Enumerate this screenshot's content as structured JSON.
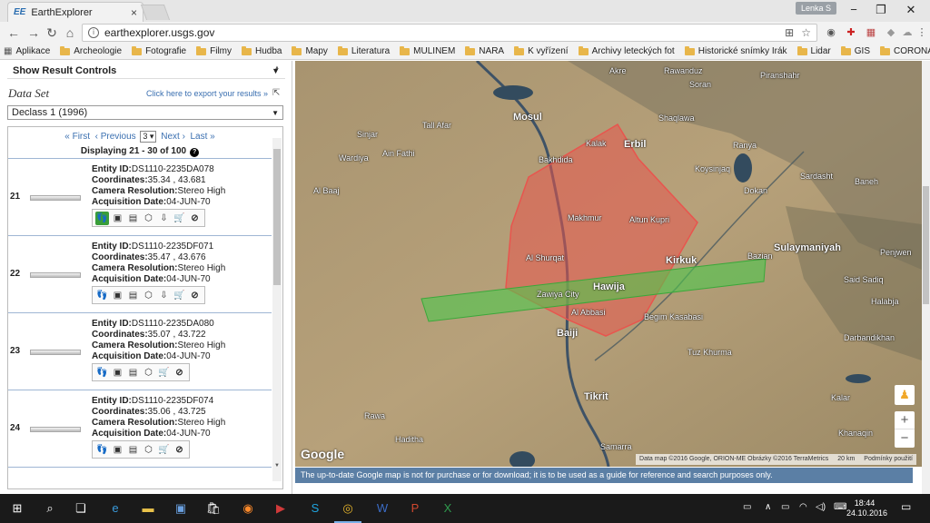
{
  "browser": {
    "tab_title": "EarthExplorer",
    "tab_icon": "EE",
    "user": "Lenka S",
    "url": "earthexplorer.usgs.gov",
    "bookmarks": [
      {
        "label": "Aplikace",
        "type": "apps"
      },
      {
        "label": "Archeologie",
        "type": "folder"
      },
      {
        "label": "Fotografie",
        "type": "folder"
      },
      {
        "label": "Filmy",
        "type": "folder"
      },
      {
        "label": "Hudba",
        "type": "folder"
      },
      {
        "label": "Mapy",
        "type": "folder"
      },
      {
        "label": "Literatura",
        "type": "folder"
      },
      {
        "label": "MULINEM",
        "type": "folder"
      },
      {
        "label": "NARA",
        "type": "folder"
      },
      {
        "label": "K vyřízení",
        "type": "folder"
      },
      {
        "label": "Archivy leteckých fot",
        "type": "folder"
      },
      {
        "label": "Historické snímky Irák",
        "type": "folder"
      },
      {
        "label": "Lidar",
        "type": "folder"
      },
      {
        "label": "GIS",
        "type": "folder"
      },
      {
        "label": "CORONA",
        "type": "folder"
      }
    ]
  },
  "panel": {
    "result_controls": "Show Result Controls",
    "dataset_title": "Data Set",
    "export_link": "Click here to export your results »",
    "dataset_value": "Declass 1 (1996)",
    "pager": {
      "first": "« First",
      "previous": "‹ Previous",
      "page": "3",
      "next": "Next ›",
      "last": "Last »"
    },
    "displaying": "Displaying 21 - 30 of 100",
    "results": [
      {
        "num": "21",
        "entity_label": "Entity ID:",
        "entity": "DS1110-2235DA078",
        "coord_label": "Coordinates:",
        "coords": "35.34 , 43.681",
        "res_label": "Camera Resolution:",
        "res": "Stereo High",
        "date_label": "Acquisition Date:",
        "date": "04-JUN-70"
      },
      {
        "num": "22",
        "entity_label": "Entity ID:",
        "entity": "DS1110-2235DF071",
        "coord_label": "Coordinates:",
        "coords": "35.47 , 43.676",
        "res_label": "Camera Resolution:",
        "res": "Stereo High",
        "date_label": "Acquisition Date:",
        "date": "04-JUN-70"
      },
      {
        "num": "23",
        "entity_label": "Entity ID:",
        "entity": "DS1110-2235DA080",
        "coord_label": "Coordinates:",
        "coords": "35.07 , 43.722",
        "res_label": "Camera Resolution:",
        "res": "Stereo High",
        "date_label": "Acquisition Date:",
        "date": "04-JUN-70"
      },
      {
        "num": "24",
        "entity_label": "Entity ID:",
        "entity": "DS1110-2235DF074",
        "coord_label": "Coordinates:",
        "coords": "35.06 , 43.725",
        "res_label": "Camera Resolution:",
        "res": "Stereo High",
        "date_label": "Acquisition Date:",
        "date": "04-JUN-70"
      }
    ]
  },
  "map": {
    "places": {
      "mosul": "Mosul",
      "erbil": "Erbil",
      "kirkuk": "Kirkuk",
      "sulaymaniyah": "Sulaymaniyah",
      "tal_afar": "Tall Afar",
      "sinjar": "Sinjar",
      "makhmur": "Makhmur",
      "altun_kupri": "Altun Kupri",
      "hawija": "Hawija",
      "baiji": "Baiji",
      "tikrit": "Tikrit",
      "tuz_khurma": "Tuz Khurma",
      "soran": "Soran",
      "rawanduz": "Rawanduz",
      "shaqlawa": "Shaqlawa",
      "koysinjaq": "Koysinjaq",
      "ranya": "Ranya",
      "dokan": "Dokan",
      "baneh": "Baneh",
      "sardasht": "Sardasht",
      "bazian": "Bazian",
      "said_sadiq": "Said Sadiq",
      "halabja": "Halabja",
      "darbandikhan": "Darbandikhan",
      "kalar": "Kalar",
      "khanaqin": "Khanaqin",
      "al_shurqat": "Al Shurqat",
      "al_abbasi": "Al Abbasi",
      "zawiya_city": "Zawiya City",
      "begim_kasabasi": "Begim Kasabasi",
      "wardiya": "Wardiya",
      "ain_fathi": "Ain Fathi",
      "al_baaj": "Al Baaj",
      "bakhdida": "Bakhdida",
      "kalak": "Kalak",
      "akre": "Akre",
      "piranshahr": "Piranshahr",
      "penjwen": "Penjwen",
      "bayji_area": "Rawa",
      "haditha": "Haditha",
      "samarra": "Samarra"
    },
    "google_logo": "Google",
    "attribution": "Data map ©2016 Google, ORION-ME Obrázky ©2016 TerraMetrics",
    "scale": "20 km",
    "terms": "Podmínky použití",
    "zoom_in": "+",
    "zoom_out": "−",
    "polygon_red_color": "#e8554e",
    "polygon_green_color": "#4cc84c"
  },
  "disclaimer": "The up-to-date Google map is not for purchase or for download; it is to be used as a guide for reference and search purposes only.",
  "taskbar": {
    "time": "18:44",
    "date": "24.10.2016"
  },
  "colors": {
    "link": "#3a6fb0",
    "disclaimer_bg": "#5b7fa5"
  }
}
